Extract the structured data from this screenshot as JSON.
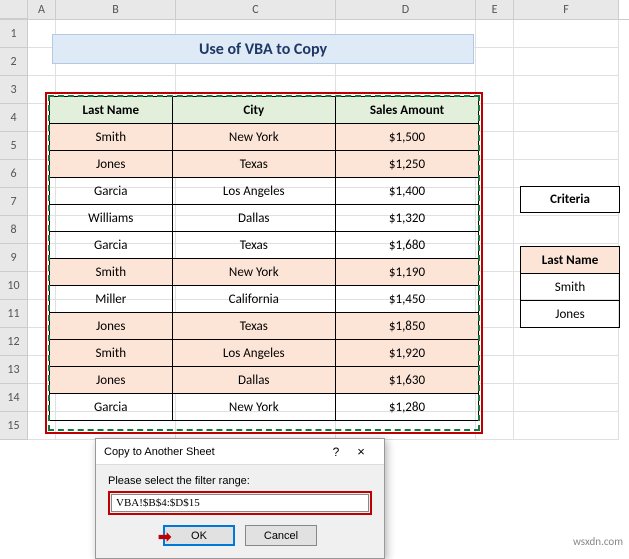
{
  "columns": [
    "A",
    "B",
    "C",
    "D",
    "E",
    "F"
  ],
  "rows": [
    "1",
    "2",
    "3",
    "4",
    "5",
    "6",
    "7",
    "8",
    "9",
    "10",
    "11",
    "12",
    "13",
    "14",
    "15"
  ],
  "title": "Use of VBA to Copy",
  "headers": {
    "b": "Last Name",
    "c": "City",
    "d": "Sales Amount"
  },
  "data": [
    {
      "b": "Smith",
      "c": "New York",
      "d": "$1,500",
      "peach": true
    },
    {
      "b": "Jones",
      "c": "Texas",
      "d": "$1,250",
      "peach": true
    },
    {
      "b": "Garcia",
      "c": "Los Angeles",
      "d": "$1,400",
      "peach": false
    },
    {
      "b": "Williams",
      "c": "Dallas",
      "d": "$1,320",
      "peach": false
    },
    {
      "b": "Garcia",
      "c": "Texas",
      "d": "$1,680",
      "peach": false
    },
    {
      "b": "Smith",
      "c": "New York",
      "d": "$1,190",
      "peach": true
    },
    {
      "b": "Miller",
      "c": "California",
      "d": "$1,450",
      "peach": false
    },
    {
      "b": "Jones",
      "c": "Texas",
      "d": "$1,850",
      "peach": true
    },
    {
      "b": "Smith",
      "c": "Los Angeles",
      "d": "$1,920",
      "peach": true
    },
    {
      "b": "Jones",
      "c": "Dallas",
      "d": "$1,630",
      "peach": true
    },
    {
      "b": "Garcia",
      "c": "New York",
      "d": "$1,280",
      "peach": false
    }
  ],
  "criteria_label": "Criteria",
  "side_header": "Last Name",
  "side_rows": [
    "Smith",
    "Jones"
  ],
  "dialog": {
    "title": "Copy to Another Sheet",
    "help": "?",
    "close": "×",
    "label": "Please select the filter range:",
    "value": "VBA!$B$4:$D$15",
    "ok": "OK",
    "cancel": "Cancel",
    "arrow": "➡"
  },
  "watermark": "wsxdn.com"
}
